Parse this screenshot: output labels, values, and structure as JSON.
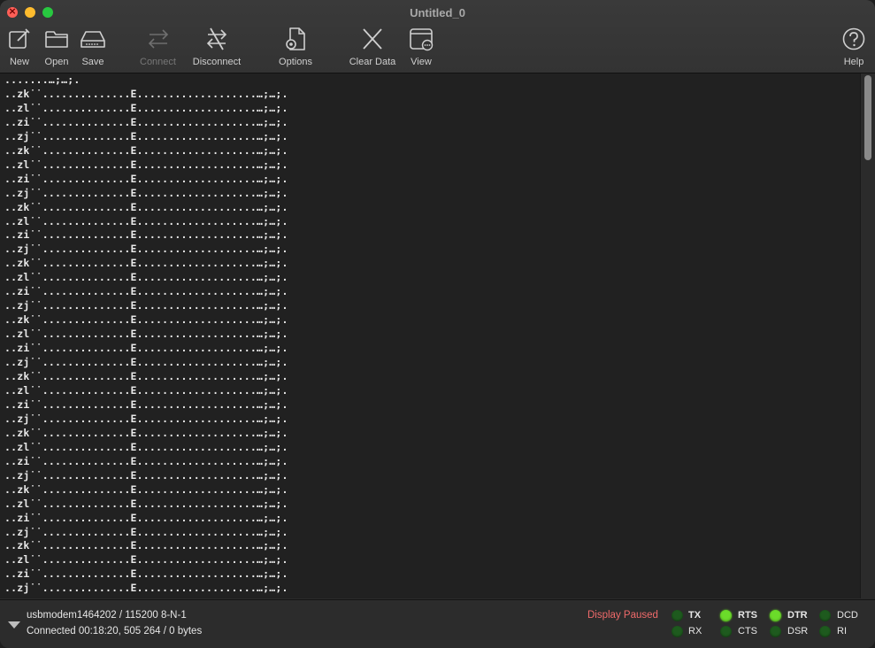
{
  "window": {
    "title": "Untitled_0"
  },
  "toolbar": {
    "new_label": "New",
    "open_label": "Open",
    "save_label": "Save",
    "connect_label": "Connect",
    "disconnect_label": "Disconnect",
    "options_label": "Options",
    "clear_label": "Clear Data",
    "view_label": "View",
    "help_label": "Help"
  },
  "terminal": {
    "lines": [
      ".......…;…;.",
      "..zk˙˙..............E...................…;…;.",
      "..zl˙˙..............E...................…;…;.",
      "..zi˙˙..............E...................…;…;.",
      "..zj˙˙..............E...................…;…;.",
      "..zk˙˙..............E...................…;…;.",
      "..zl˙˙..............E...................…;…;.",
      "..zi˙˙..............E...................…;…;.",
      "..zj˙˙..............E...................…;…;.",
      "..zk˙˙..............E...................…;…;.",
      "..zl˙˙..............E...................…;…;.",
      "..zi˙˙..............E...................…;…;.",
      "..zj˙˙..............E...................…;…;.",
      "..zk˙˙..............E...................…;…;.",
      "..zl˙˙..............E...................…;…;.",
      "..zi˙˙..............E...................…;…;.",
      "..zj˙˙..............E...................…;…;.",
      "..zk˙˙..............E...................…;…;.",
      "..zl˙˙..............E...................…;…;.",
      "..zi˙˙..............E...................…;…;.",
      "..zj˙˙..............E...................…;…;.",
      "..zk˙˙..............E...................…;…;.",
      "..zl˙˙..............E...................…;…;.",
      "..zi˙˙..............E...................…;…;.",
      "..zj˙˙..............E...................…;…;.",
      "..zk˙˙..............E...................…;…;.",
      "..zl˙˙..............E...................…;…;.",
      "..zi˙˙..............E...................…;…;.",
      "..zj˙˙..............E...................…;…;.",
      "..zk˙˙..............E...................…;…;.",
      "..zl˙˙..............E...................…;…;.",
      "..zi˙˙..............E...................…;…;.",
      "..zj˙˙..............E...................…;…;.",
      "..zk˙˙..............E...................…;…;.",
      "..zl˙˙..............E...................…;…;.",
      "..zi˙˙..............E...................…;…;.",
      "..zj˙˙..............E...................…;…;."
    ]
  },
  "status": {
    "port": "usbmodem1464202 / 115200 8-N-1",
    "connection": "Connected 00:18:20, 505 264 / 0 bytes",
    "paused": "Display Paused",
    "paused_color": "#ef6a6a"
  },
  "signals": {
    "tx": {
      "label": "TX",
      "on": false
    },
    "rx": {
      "label": "RX",
      "on": false
    },
    "rts": {
      "label": "RTS",
      "on": true
    },
    "cts": {
      "label": "CTS",
      "on": false
    },
    "dtr": {
      "label": "DTR",
      "on": true
    },
    "dsr": {
      "label": "DSR",
      "on": false
    },
    "dcd": {
      "label": "DCD",
      "on": false
    },
    "ri": {
      "label": "RI",
      "on": false
    },
    "on_color": "#6bdc2a",
    "off_color": "#1e5a1e"
  }
}
